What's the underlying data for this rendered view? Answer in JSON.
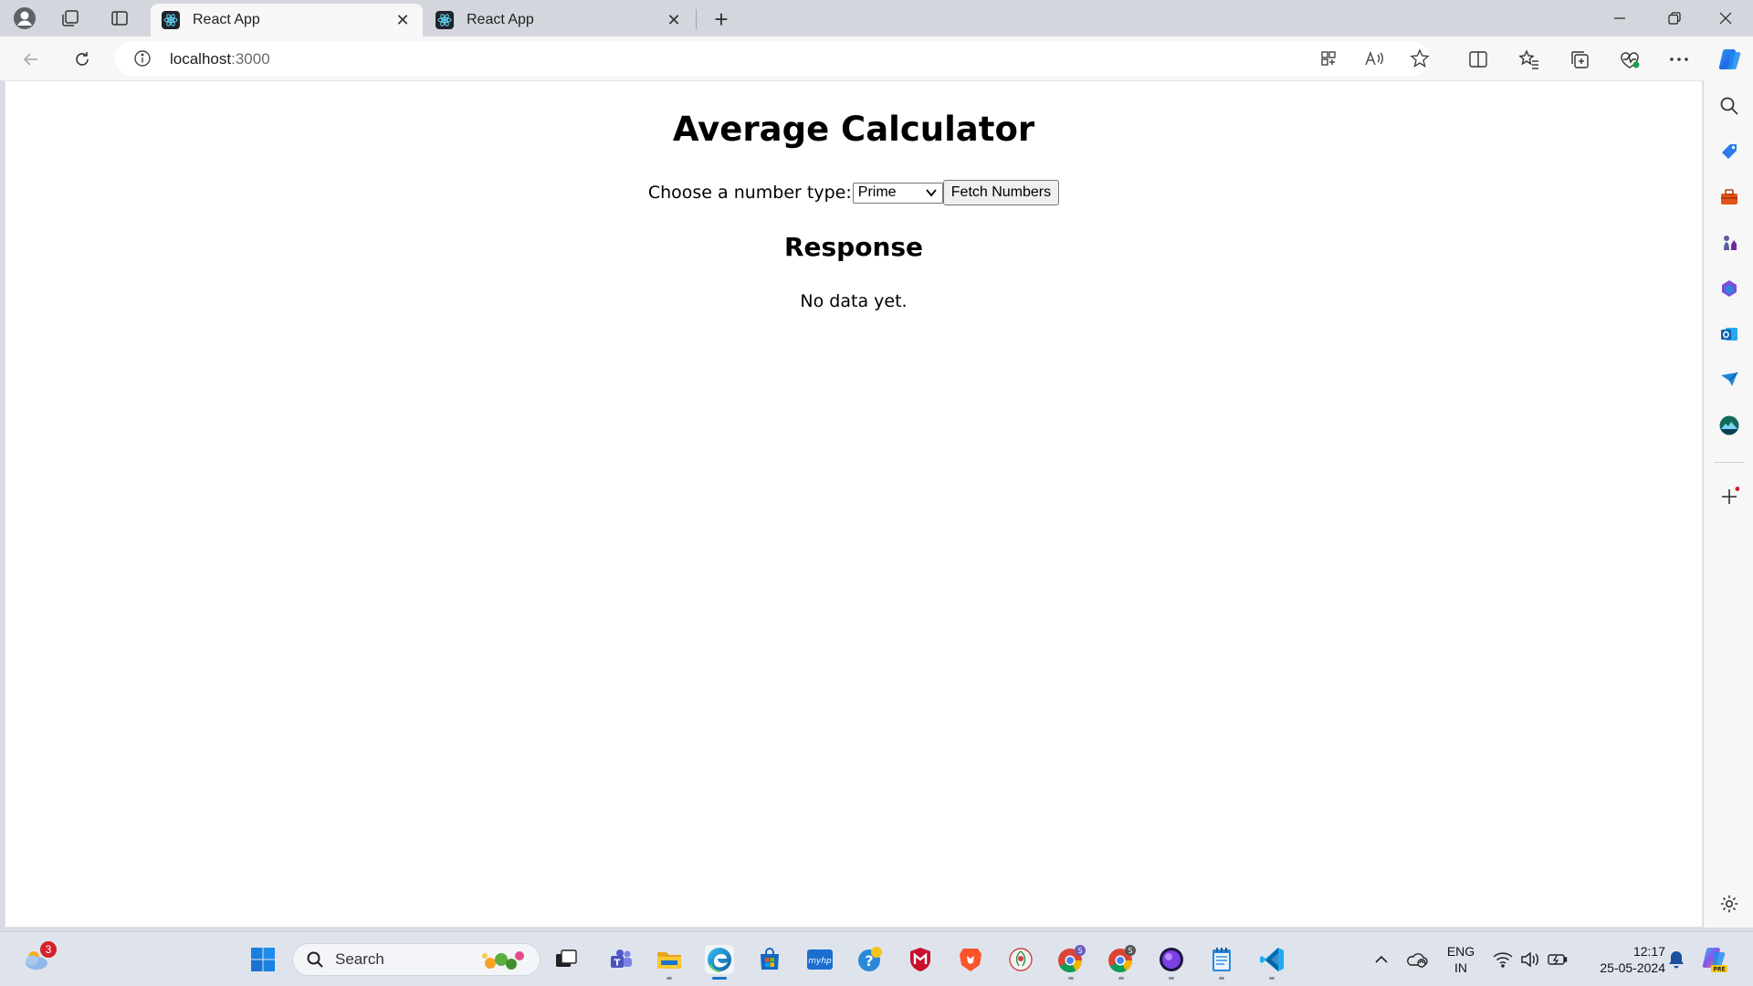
{
  "browser": {
    "tabs": [
      {
        "title": "React App",
        "active": true
      },
      {
        "title": "React App",
        "active": false
      }
    ],
    "address": {
      "host": "localhost",
      "port": ":3000"
    }
  },
  "page": {
    "title": "Average Calculator",
    "choose_label": "Choose a number type:",
    "select": {
      "selected": "Prime"
    },
    "fetch_button": "Fetch Numbers",
    "response_title": "Response",
    "response_text": "No data yet."
  },
  "taskbar": {
    "weather_badge": "3",
    "search_placeholder": "Search",
    "language_line1": "ENG",
    "language_line2": "IN",
    "time": "12:17",
    "date": "25-05-2024"
  },
  "colors": {
    "accent": "#1a73c8",
    "edge_blue": "#0c59a4",
    "react_cyan": "#61dafb"
  }
}
